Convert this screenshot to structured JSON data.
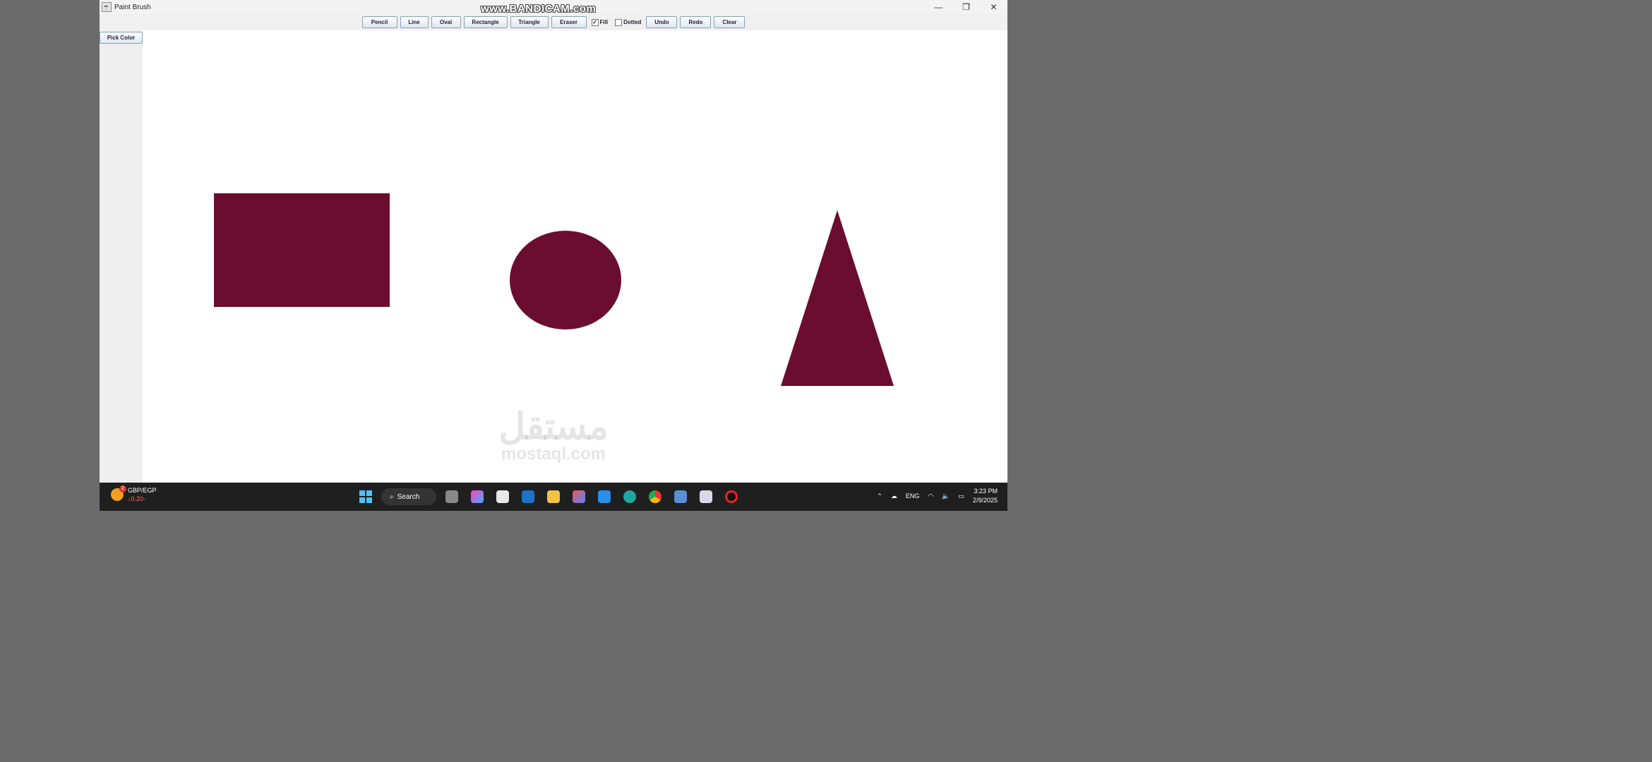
{
  "window": {
    "title": "Paint Brush",
    "controls": [
      "—",
      "❐",
      "✕"
    ]
  },
  "watermark": "www.BANDICAM.com",
  "toolbar": {
    "buttons": [
      "Pencil",
      "Line",
      "Oval",
      "Rectangle",
      "Triangle",
      "Eraser"
    ],
    "fill_label": "Fill",
    "fill_checked": true,
    "dotted_label": "Dotted",
    "dotted_checked": false,
    "undo": "Undo",
    "redo": "Redo",
    "clear": "Clear"
  },
  "sidebar": {
    "pick_color": "Pick Color"
  },
  "canvas": {
    "shape_color": "#6b0d2f",
    "shapes": [
      "rectangle",
      "oval",
      "triangle"
    ]
  },
  "logo": {
    "arabic": "مستقل",
    "latin": "mostaql.com"
  },
  "taskbar": {
    "ticker": {
      "pair": "GBP/EGP",
      "change": "↓0.20-",
      "badge": "2"
    },
    "search_label": "Search",
    "tray": {
      "language": "ENG",
      "time": "3:23 PM",
      "date": "2/9/2025"
    }
  }
}
